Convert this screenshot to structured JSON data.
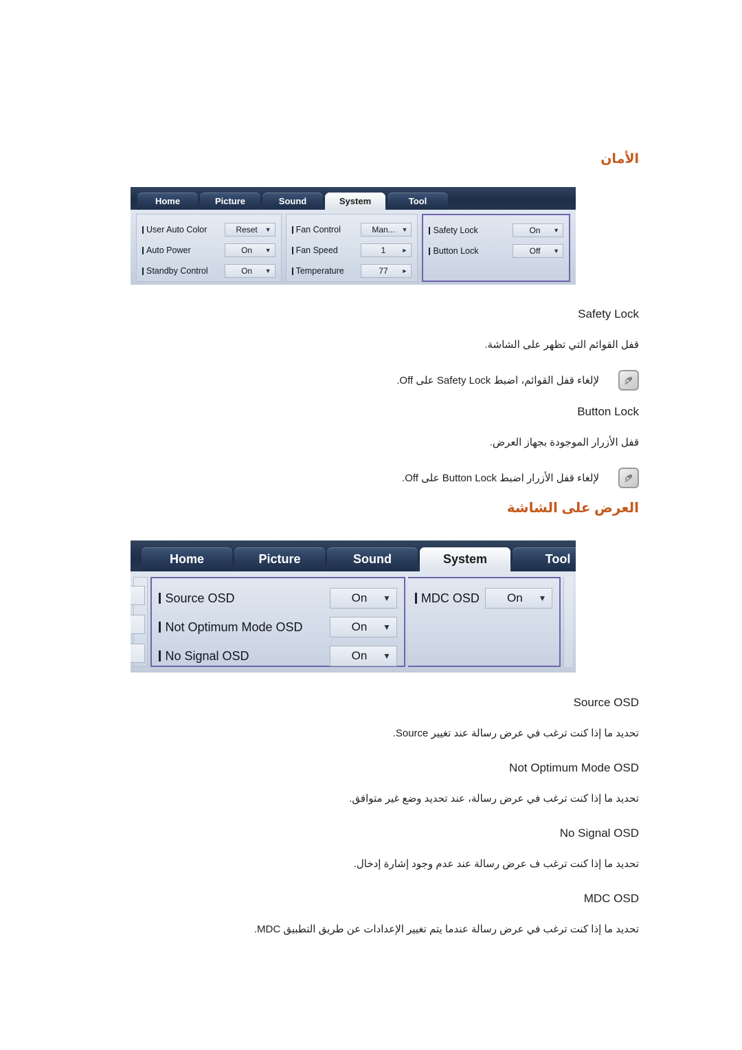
{
  "document": {
    "language": "ar",
    "background_color": "#ffffff",
    "heading_color": "#c55a1e"
  },
  "sections": [
    {
      "id": "security",
      "heading": "الأمان"
    },
    {
      "id": "osd",
      "heading": "العرض على الشاشة"
    }
  ],
  "osd_panel_1": {
    "tabs": [
      {
        "label": "Home",
        "active": false
      },
      {
        "label": "Picture",
        "active": false
      },
      {
        "label": "Sound",
        "active": false
      },
      {
        "label": "System",
        "active": true
      },
      {
        "label": "Tool",
        "active": false
      }
    ],
    "columns": [
      {
        "highlight": false,
        "rows": [
          {
            "label": "User Auto Color",
            "value": "Reset",
            "control": "dropdown"
          },
          {
            "label": "Auto Power",
            "value": "On",
            "control": "dropdown"
          },
          {
            "label": "Standby Control",
            "value": "On",
            "control": "dropdown"
          }
        ]
      },
      {
        "highlight": false,
        "rows": [
          {
            "label": "Fan Control",
            "value": "Man...",
            "control": "dropdown"
          },
          {
            "label": "Fan Speed",
            "value": "1",
            "control": "spinner"
          },
          {
            "label": "Temperature",
            "value": "77",
            "control": "spinner"
          }
        ]
      },
      {
        "highlight": true,
        "rows": [
          {
            "label": "Safety Lock",
            "value": "On",
            "control": "dropdown"
          },
          {
            "label": "Button Lock",
            "value": "Off",
            "control": "dropdown"
          }
        ]
      }
    ],
    "highlight_border_color": "#6f63ae"
  },
  "osd_panel_2": {
    "tabs": [
      {
        "label": "Home",
        "active": false
      },
      {
        "label": "Picture",
        "active": false
      },
      {
        "label": "Sound",
        "active": false
      },
      {
        "label": "System",
        "active": true
      },
      {
        "label": "Tool",
        "active": false
      }
    ],
    "columns": [
      {
        "highlight": true,
        "rows": [
          {
            "label": "Source OSD",
            "value": "On",
            "control": "dropdown"
          },
          {
            "label": "Not Optimum Mode OSD",
            "value": "On",
            "control": "dropdown"
          },
          {
            "label": "No Signal OSD",
            "value": "On",
            "control": "dropdown"
          }
        ]
      },
      {
        "highlight": true,
        "rows": [
          {
            "label": "MDC OSD",
            "value": "On",
            "control": "dropdown"
          }
        ]
      }
    ],
    "highlight_border_color": "#6f63ae"
  },
  "entries": {
    "safety_lock": {
      "term": "Safety Lock",
      "description": "قفل القوائم التي تظهر على الشاشة.",
      "note": "لإلغاء قفل القوائم، اضبط Safety Lock على Off.",
      "note_icon": "note-hand-icon"
    },
    "button_lock": {
      "term": "Button Lock",
      "description": "قفل الأزرار الموجودة بجهاز العرض.",
      "note": "لإلغاء قفل الأزرار اضبط Button Lock على Off.",
      "note_icon": "note-hand-icon"
    },
    "source_osd": {
      "term": "Source OSD",
      "description": "تحديد ما إذا كنت ترغب في عرض رسالة عند تغيير Source."
    },
    "not_optimum_mode_osd": {
      "term": "Not Optimum Mode OSD",
      "description": "تحديد ما إذا كنت ترغب في عرض رسالة، عند تحديد وضع غير متوافق."
    },
    "no_signal_osd": {
      "term": "No Signal OSD",
      "description": "تحديد ما إذا كنت ترغب ف عرض رسالة عند عدم وجود إشارة إدخال."
    },
    "mdc_osd": {
      "term": "MDC OSD",
      "description": "تحديد ما إذا كنت ترغب في عرض رسالة عندما يتم تغيير الإعدادات عن طريق التطبيق MDC."
    }
  }
}
